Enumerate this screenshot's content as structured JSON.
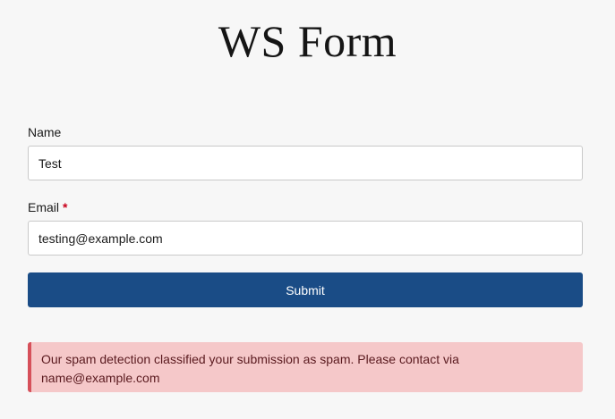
{
  "header": {
    "logo_text": "WS Form"
  },
  "form": {
    "name_label": "Name",
    "name_value": "Test",
    "email_label": "Email",
    "email_required_marker": "*",
    "email_value": "testing@example.com",
    "submit_label": "Submit",
    "error_message": "Our spam detection classified your submission as spam. Please contact via name@example.com"
  },
  "colors": {
    "background": "#f7f7f7",
    "submit_button": "#1a4c86",
    "required_marker": "#c9001b",
    "alert_background": "#f5c8c9",
    "alert_border": "#d6505a"
  }
}
